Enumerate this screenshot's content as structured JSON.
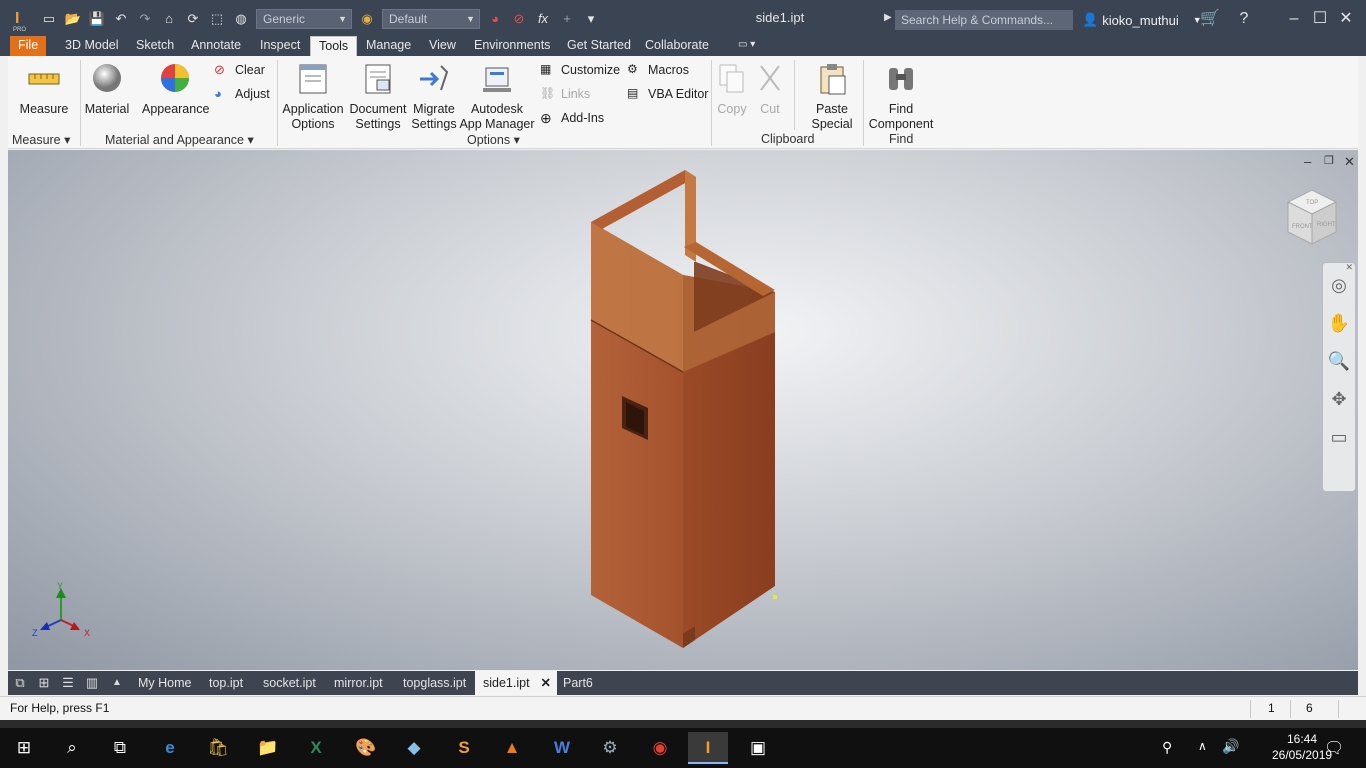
{
  "titlebar": {
    "title": "side1.ipt",
    "style_dropdown": "Generic",
    "appearance_dropdown": "Default",
    "search_placeholder": "Search Help & Commands...",
    "username": "kioko_muthui"
  },
  "tabs": [
    "File",
    "3D Model",
    "Sketch",
    "Annotate",
    "Inspect",
    "Tools",
    "Manage",
    "View",
    "Environments",
    "Get Started",
    "Collaborate"
  ],
  "active_tab": "Tools",
  "ribbon": {
    "measure": "Measure",
    "material": "Material",
    "appearance": "Appearance",
    "clear": "Clear",
    "adjust": "Adjust",
    "app_options_1": "Application",
    "app_options_2": "Options",
    "doc_settings_1": "Document",
    "doc_settings_2": "Settings",
    "migrate_1": "Migrate",
    "migrate_2": "Settings",
    "app_manager_1": "Autodesk",
    "app_manager_2": "App Manager",
    "customize": "Customize",
    "links": "Links",
    "add_ins": "Add-Ins",
    "macros": "Macros",
    "vba_editor": "VBA Editor",
    "copy": "Copy",
    "cut": "Cut",
    "paste_special_1": "Paste",
    "paste_special_2": "Special",
    "find_component_1": "Find",
    "find_component_2": "Component",
    "panels": {
      "measure": "Measure",
      "material_appearance": "Material and Appearance",
      "options": "Options",
      "clipboard": "Clipboard",
      "find": "Find"
    }
  },
  "viewcube": {
    "top": "TOP",
    "front": "FRONT",
    "right": "RIGHT"
  },
  "triad": {
    "x": "X",
    "y": "Y",
    "z": "Z"
  },
  "document_tabs": [
    "My Home",
    "top.ipt",
    "socket.ipt",
    "mirror.ipt",
    "topglass.ipt",
    "side1.ipt",
    "Part6"
  ],
  "active_document": "side1.ipt",
  "status": {
    "help": "For Help, press F1",
    "count_1": "1",
    "count_2": "6"
  },
  "taskbar": {
    "time": "16:44",
    "date": "26/05/2019"
  },
  "colors": {
    "accent": "#e4711a",
    "titlebar": "#3b4453",
    "wood": "#a0552e"
  }
}
